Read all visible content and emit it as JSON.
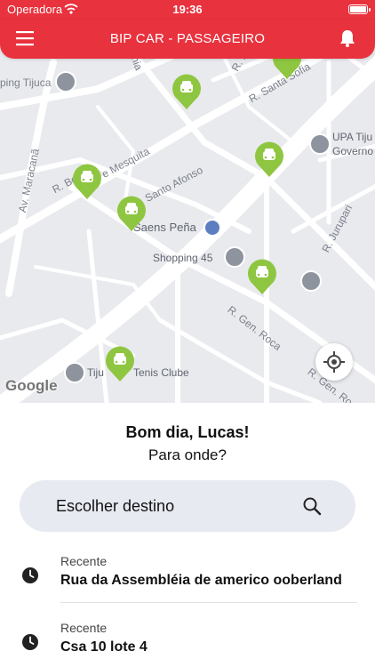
{
  "status_bar": {
    "carrier": "Operadora",
    "time": "19:36"
  },
  "header": {
    "title": "BIP CAR  - PASSAGEIRO",
    "menu_icon": "hamburger-menu-icon",
    "bell_icon": "bell-icon"
  },
  "map": {
    "streets": [
      "R. Santa Sofia",
      "R. Barão de Mesquita",
      "Santo Afonso",
      "Av. Maracanã",
      "R. Gen. Roca",
      "R. Gen. Roca",
      "R. Jurupari",
      "R. B",
      "nia",
      "R. Bo",
      "e Mesquita"
    ],
    "places": {
      "tijuca": "ping Tijuca",
      "upa": "UPA Tiju",
      "upa_line2": "Governo",
      "saens_pena": "Saens Peña",
      "shopping": "Shopping 45",
      "tenis": "Tiju",
      "tenis_rest": "Tenis Clube"
    },
    "attribution": "Google",
    "car_color": "#8fc641"
  },
  "panel": {
    "greeting": "Bom dia, Lucas!",
    "question": "Para onde?",
    "search_placeholder": "Escolher destino",
    "recents": [
      {
        "label": "Recente",
        "address": "Rua da Assembléia de americo ooberland"
      },
      {
        "label": "Recente",
        "address": "Csa 10 lote 4"
      }
    ]
  },
  "colors": {
    "brand": "#e8323e",
    "search_bg": "#e8eaf2"
  }
}
